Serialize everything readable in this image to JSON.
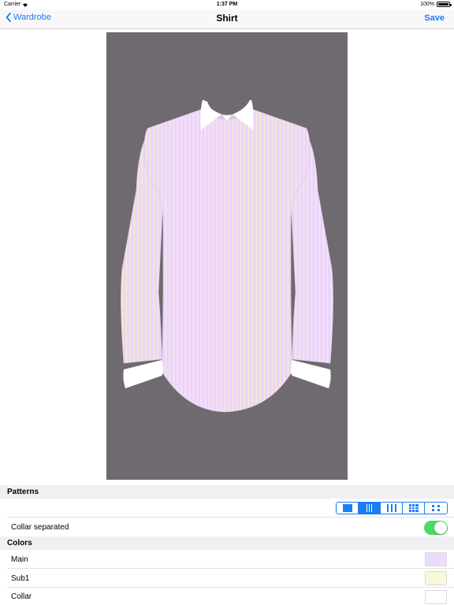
{
  "status_bar": {
    "carrier": "Carrier",
    "time": "1:37 PM",
    "battery": "100%"
  },
  "nav": {
    "back_label": "Wardrobe",
    "title": "Shirt",
    "save_label": "Save"
  },
  "colors": {
    "accent": "#1e7cf6",
    "preview_background": "#6e6a6f",
    "shirt_main": "#efd9fa",
    "shirt_stripe": "#f7f3c8",
    "collar": "#ffffff",
    "switch_on": "#4cd964"
  },
  "patterns_section": {
    "header": "Patterns",
    "options": [
      {
        "name": "solid",
        "selected": false
      },
      {
        "name": "wide-stripe",
        "selected": true
      },
      {
        "name": "stripe",
        "selected": false
      },
      {
        "name": "check",
        "selected": false
      },
      {
        "name": "dots",
        "selected": false
      }
    ]
  },
  "collar_row": {
    "label": "Collar separated",
    "on": true
  },
  "colors_section": {
    "header": "Colors",
    "rows": [
      {
        "label": "Main",
        "swatch": "#ecdcf9"
      },
      {
        "label": "Sub1",
        "swatch": "#f9f9da"
      },
      {
        "label": "Collar",
        "swatch": "#ffffff"
      }
    ]
  }
}
